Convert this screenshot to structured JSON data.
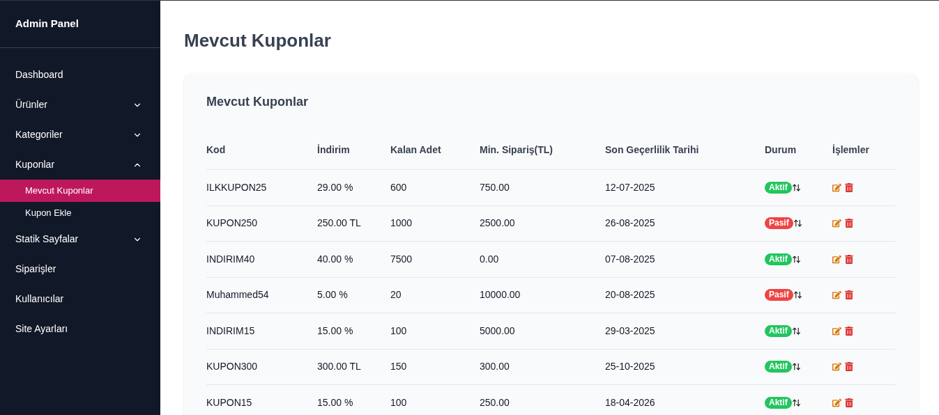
{
  "sidebar": {
    "title": "Admin Panel",
    "items": [
      {
        "label": "Dashboard"
      },
      {
        "label": "Ürünler",
        "expanded": false
      },
      {
        "label": "Kategoriler",
        "expanded": false
      },
      {
        "label": "Kuponlar",
        "expanded": true,
        "children": [
          {
            "label": "Mevcut Kuponlar",
            "selected": true
          },
          {
            "label": "Kupon Ekle",
            "selected": false
          }
        ]
      },
      {
        "label": "Statik Sayfalar",
        "expanded": false
      },
      {
        "label": "Siparişler"
      },
      {
        "label": "Kullanıcılar"
      },
      {
        "label": "Site Ayarları"
      }
    ]
  },
  "page_title": "Mevcut Kuponlar",
  "card": {
    "title": "Mevcut Kuponlar",
    "table": {
      "columns": [
        "Kod",
        "İndirim",
        "Kalan Adet",
        "Min. Sipariş(TL)",
        "Son Geçerlilik Tarihi",
        "Durum",
        "İşlemler"
      ],
      "rows": [
        {
          "code": "ILKKUPON25",
          "discount": "29.00 %",
          "remaining": "600",
          "min_order": "750.00",
          "expiry": "12-07-2025",
          "status": {
            "label": "Aktif",
            "kind": "active"
          }
        },
        {
          "code": "KUPON250",
          "discount": "250.00 TL",
          "remaining": "1000",
          "min_order": "2500.00",
          "expiry": "26-08-2025",
          "status": {
            "label": "Pasif",
            "kind": "passive"
          }
        },
        {
          "code": "INDIRIM40",
          "discount": "40.00 %",
          "remaining": "7500",
          "min_order": "0.00",
          "expiry": "07-08-2025",
          "status": {
            "label": "Aktif",
            "kind": "active"
          }
        },
        {
          "code": "Muhammed54",
          "discount": "5.00 %",
          "remaining": "20",
          "min_order": "10000.00",
          "expiry": "20-08-2025",
          "status": {
            "label": "Pasif",
            "kind": "passive"
          }
        },
        {
          "code": "INDIRIM15",
          "discount": "15.00 %",
          "remaining": "100",
          "min_order": "5000.00",
          "expiry": "29-03-2025",
          "status": {
            "label": "Aktif",
            "kind": "active"
          }
        },
        {
          "code": "KUPON300",
          "discount": "300.00 TL",
          "remaining": "150",
          "min_order": "300.00",
          "expiry": "25-10-2025",
          "status": {
            "label": "Aktif",
            "kind": "active"
          }
        },
        {
          "code": "KUPON15",
          "discount": "15.00 %",
          "remaining": "100",
          "min_order": "250.00",
          "expiry": "18-04-2026",
          "status": {
            "label": "Aktif",
            "kind": "active"
          }
        }
      ]
    }
  }
}
